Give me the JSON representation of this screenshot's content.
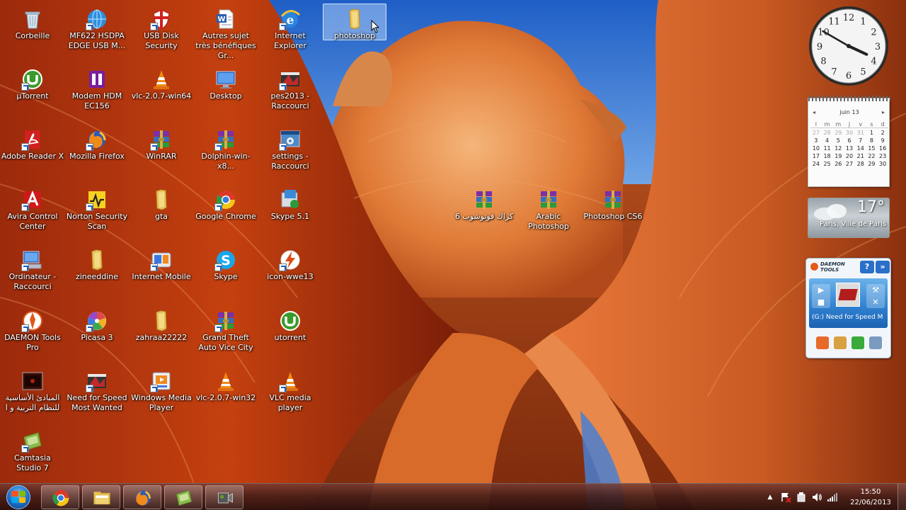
{
  "desktop": {
    "icons": [
      {
        "id": "corbeille",
        "label": "Corbeille",
        "icon": "recycle-bin-icon"
      },
      {
        "id": "mf622",
        "label": "MF622 HSDPA EDGE USB M...",
        "icon": "modem-globe-icon"
      },
      {
        "id": "usb-disk-security",
        "label": "USB Disk Security",
        "icon": "shield-icon"
      },
      {
        "id": "autres-sujet",
        "label": "Autres sujet très bénéfiques Gr...",
        "icon": "word-document-icon"
      },
      {
        "id": "internet-explorer",
        "label": "Internet Explorer",
        "icon": "internet-explorer-icon"
      },
      {
        "id": "photoshop-folder",
        "label": "photoshop",
        "icon": "folder-icon"
      },
      {
        "id": "utorrent",
        "label": "µTorrent",
        "icon": "utorrent-icon"
      },
      {
        "id": "modem-hdm",
        "label": "Modem HDM EC156",
        "icon": "modem-icon"
      },
      {
        "id": "vlc-win64",
        "label": "vlc-2.0.7-win64",
        "icon": "vlc-cone-icon"
      },
      {
        "id": "desktop",
        "label": "Desktop",
        "icon": "monitor-icon"
      },
      {
        "id": "pes2013",
        "label": "pes2013 - Raccourci",
        "icon": "game-icon"
      },
      {
        "id": "adobe-reader",
        "label": "Adobe Reader X",
        "icon": "adobe-reader-icon"
      },
      {
        "id": "mozilla-firefox",
        "label": "Mozilla Firefox",
        "icon": "firefox-icon"
      },
      {
        "id": "winrar",
        "label": "WinRAR",
        "icon": "winrar-icon"
      },
      {
        "id": "dolphin",
        "label": "Dolphin-win-x8...",
        "icon": "winrar-archive-icon"
      },
      {
        "id": "settings",
        "label": "settings - Raccourci",
        "icon": "settings-window-icon"
      },
      {
        "id": "avira",
        "label": "Avira Control Center",
        "icon": "avira-umbrella-icon"
      },
      {
        "id": "norton",
        "label": "Norton Security Scan",
        "icon": "norton-scan-icon"
      },
      {
        "id": "gta",
        "label": "gta",
        "icon": "folder-icon"
      },
      {
        "id": "google-chrome",
        "label": "Google Chrome",
        "icon": "chrome-icon"
      },
      {
        "id": "skype-51",
        "label": "Skype 5.1",
        "icon": "installer-icon"
      },
      {
        "id": "ordinateur",
        "label": "Ordinateur - Raccourci",
        "icon": "computer-icon"
      },
      {
        "id": "zineeddine",
        "label": "zineeddine",
        "icon": "folder-icon"
      },
      {
        "id": "internet-mobile",
        "label": "Internet Mobile",
        "icon": "internet-mobile-icon"
      },
      {
        "id": "skype",
        "label": "Skype",
        "icon": "skype-icon"
      },
      {
        "id": "icon-wwe13",
        "label": "icon-wwe13",
        "icon": "lightning-icon"
      },
      {
        "id": "daemon-tools-pro",
        "label": "DAEMON Tools Pro",
        "icon": "daemon-tools-icon"
      },
      {
        "id": "picasa",
        "label": "Picasa 3",
        "icon": "picasa-icon"
      },
      {
        "id": "zahraa",
        "label": "zahraa22222",
        "icon": "folder-icon"
      },
      {
        "id": "gta-vice-city",
        "label": "Grand Theft Auto Vice City",
        "icon": "winrar-archive-icon"
      },
      {
        "id": "utorrent2",
        "label": "utorrent",
        "icon": "utorrent-icon"
      },
      {
        "id": "arabic-doc",
        "label": "المبادئ الأساسية للنظام التربية و ا",
        "icon": "dark-video-icon"
      },
      {
        "id": "nfs-most-wanted",
        "label": "Need for Speed Most Wanted",
        "icon": "game-icon"
      },
      {
        "id": "windows-media-player",
        "label": "Windows Media Player",
        "icon": "media-player-icon"
      },
      {
        "id": "vlc-win32",
        "label": "vlc-2.0.7-win32",
        "icon": "vlc-cone-icon"
      },
      {
        "id": "vlc-media-player",
        "label": "VLC media player",
        "icon": "vlc-cone-icon"
      },
      {
        "id": "camtasia",
        "label": "Camtasia Studio 7",
        "icon": "camtasia-icon"
      },
      {
        "id": "arabic-photoshop-rar1",
        "label": "كراك فوتوشوب 6",
        "icon": "winrar-archive-icon"
      },
      {
        "id": "arabic-photoshop-rar2",
        "label": "Arabic Photoshop",
        "icon": "winrar-archive-icon"
      },
      {
        "id": "photoshop-cs6",
        "label": "Photoshop CS6",
        "icon": "winrar-archive-icon"
      }
    ]
  },
  "gadgets": {
    "clock": {
      "hours": 3,
      "minutes": 50
    },
    "calendar": {
      "month_label": "juin 13",
      "prev": "◂",
      "next": "▸",
      "weekdays": [
        "l",
        "m",
        "m",
        "j",
        "v",
        "s",
        "d"
      ],
      "today": "22",
      "cells": [
        "27",
        "28",
        "29",
        "30",
        "31",
        "1",
        "2",
        "3",
        "4",
        "5",
        "6",
        "7",
        "8",
        "9",
        "10",
        "11",
        "12",
        "13",
        "14",
        "15",
        "16",
        "17",
        "18",
        "19",
        "20",
        "21",
        "22",
        "23",
        "24",
        "25",
        "26",
        "27",
        "28",
        "29",
        "30"
      ]
    },
    "weather": {
      "temperature": "17°",
      "city": "Paris, Ville de Paris"
    },
    "daemon_tools": {
      "logo_line1": "DAEMON",
      "logo_line2": "TOOLS",
      "help": "?",
      "rss": "»",
      "drive_label": "(G:) Need for Speed M"
    }
  },
  "taskbar": {
    "pinned": [
      {
        "id": "chrome",
        "icon": "chrome-icon"
      },
      {
        "id": "explorer",
        "icon": "file-explorer-icon"
      },
      {
        "id": "firefox",
        "icon": "firefox-icon"
      },
      {
        "id": "camtasia",
        "icon": "camtasia-icon"
      },
      {
        "id": "recorder",
        "icon": "video-recorder-icon"
      }
    ],
    "tray": {
      "show_hidden": "▲",
      "time": "15:50",
      "date": "22/06/2013"
    }
  },
  "colors": {
    "taskbar": "#3b1410",
    "selection": "#c8e1ff",
    "today": "#f08a24"
  }
}
